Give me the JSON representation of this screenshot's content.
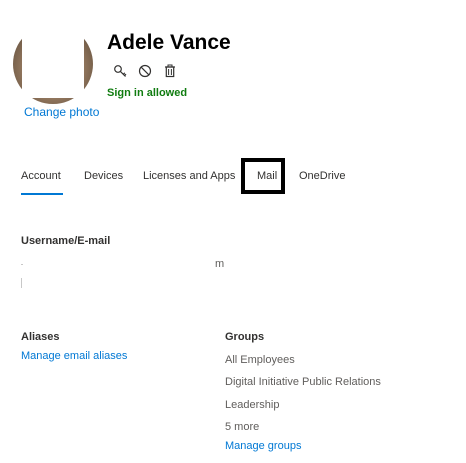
{
  "user": {
    "display_name": "Adele Vance",
    "signin_status": "Sign in allowed",
    "change_photo_label": "Change photo"
  },
  "actions": [
    {
      "icon": "key-icon",
      "label": "Reset password"
    },
    {
      "icon": "block-icon",
      "label": "Block sign-in"
    },
    {
      "icon": "trash-icon",
      "label": "Delete user"
    }
  ],
  "tabs": [
    {
      "label": "Account",
      "active": true
    },
    {
      "label": "Devices",
      "active": false
    },
    {
      "label": "Licenses and Apps",
      "active": false
    },
    {
      "label": "Mail",
      "active": false
    },
    {
      "label": "OneDrive",
      "active": false
    }
  ],
  "username": {
    "label": "Username/E-mail",
    "value_fragment": "m"
  },
  "aliases": {
    "label": "Aliases",
    "link": "Manage email aliases"
  },
  "groups": {
    "label": "Groups",
    "items": [
      "All Employees",
      "Digital Initiative Public Relations",
      "Leadership"
    ],
    "more": "5 more",
    "link": "Manage groups"
  },
  "colors": {
    "accent": "#0078d4",
    "success": "#107c10",
    "text": "#323130",
    "muted": "#605e5c"
  }
}
